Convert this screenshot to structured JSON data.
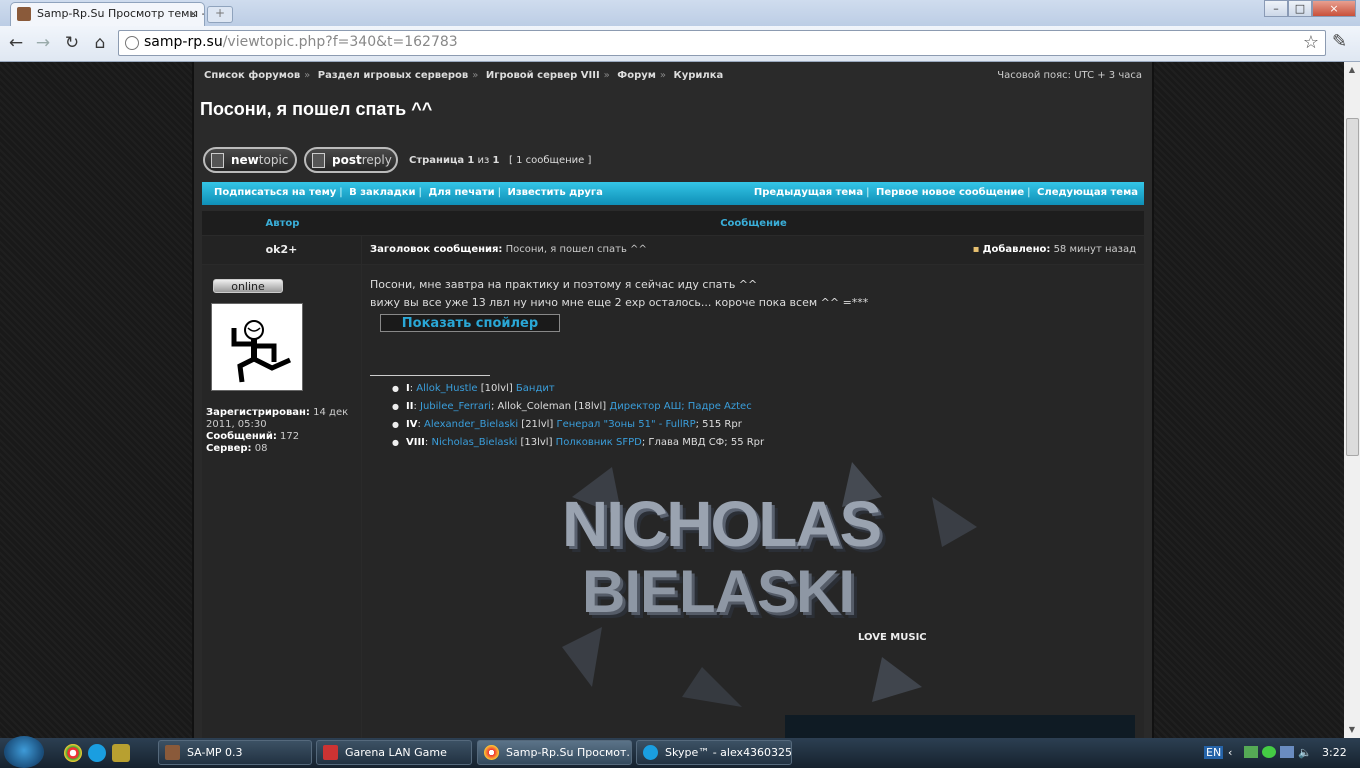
{
  "browser": {
    "tab_title": "Samp-Rp.Su Просмотр темы -",
    "tab_close": "×",
    "new_tab": "+",
    "url_domain": "samp-rp.su",
    "url_path": "/viewtopic.php?f=340&t=162783",
    "window_min": "–",
    "window_max": "□",
    "window_close": "×"
  },
  "breadcrumbs": [
    "Список форумов",
    "Раздел игровых серверов",
    "Игровой сервер VIII",
    "Форум",
    "Курилка"
  ],
  "timezone": "Часовой пояс: UTC + 3 часа",
  "topic_title": "Посони, я пошел спать ^^",
  "buttons": {
    "new_topic_a": "new",
    "new_topic_b": "topic",
    "post_reply_a": "post",
    "post_reply_b": "reply"
  },
  "pagination": {
    "label": "Страница",
    "current": "1",
    "of": "из",
    "total": "1",
    "count": "[ 1 сообщение ]"
  },
  "actions_left": [
    "Подписаться на тему",
    "В закладки",
    "Для печати",
    "Известить друга"
  ],
  "actions_right": [
    "Предыдущая тема",
    "Первое новое сообщение",
    "Следующая тема"
  ],
  "table": {
    "col_author": "Автор",
    "col_message": "Сообщение"
  },
  "post": {
    "author": "ok2+",
    "subject_label": "Заголовок сообщения:",
    "subject": "Посони, я пошел спать ^^",
    "posted_label": "Добавлено:",
    "posted_time": "58 минут назад",
    "status": "online",
    "registered_label": "Зарегистрирован:",
    "registered": "14 дек 2011, 05:30",
    "posts_label": "Сообщений:",
    "posts": "172",
    "server_label": "Сервер:",
    "server": "08",
    "line1": "Посони, мне завтра на практику и поэтому я сейчас иду спать ^^",
    "line2": "вижу вы все уже 13 лвл ну ничо мне еще 2 exp осталось... короче пока всем ^^ =***",
    "spoiler": "Показать спойлер"
  },
  "signature": {
    "chars": [
      {
        "roman": "I",
        "name": "Allok_Hustle",
        "lvl": "[10lvl]",
        "role": "Бандит",
        "extra": ""
      },
      {
        "roman": "II",
        "name": "Jubilee_Ferrari",
        "lvl": "; Allok_Coleman [18lvl]",
        "role": "Директор АШ; Падре Aztec",
        "extra": ""
      },
      {
        "roman": "IV",
        "name": "Alexander_Bielaski",
        "lvl": "[21lvl]",
        "role": "Генерал \"Зоны 51\" - FullRP",
        "extra": "; 515 Rpr"
      },
      {
        "roman": "VIII",
        "name": "Nicholas_Bielaski",
        "lvl": "[13lvl]",
        "role": "Полковник SFPD",
        "extra": "; Глава МВД СФ; 55 Rpr"
      }
    ],
    "banner_line1": "NICHOLAS",
    "banner_line2": "BIELASKI",
    "banner_tag": "LOVE MUSIC"
  },
  "taskbar": {
    "items": [
      "SA-MP 0.3",
      "Garena LAN Game",
      "Samp-Rp.Su Просмот...",
      "Skype™ - alex4360325"
    ],
    "lang": "EN",
    "clock": "3:22"
  }
}
